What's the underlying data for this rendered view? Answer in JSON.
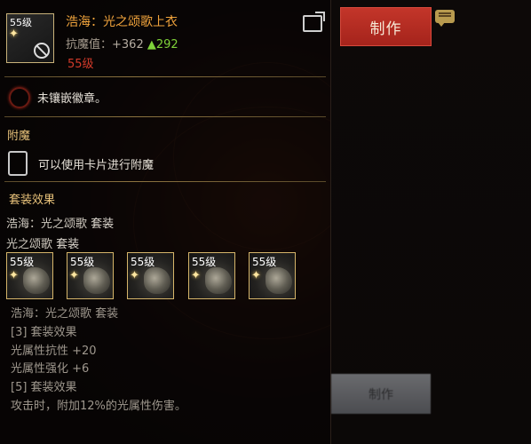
{
  "item": {
    "level_badge": "55级",
    "name": "浩海：光之颂歌上衣",
    "stat_label": "抗魔值：",
    "stat_value": "+362",
    "stat_increase": "▲292",
    "required_level": "55级"
  },
  "badge": {
    "text": "未镶嵌徽章。"
  },
  "enchant": {
    "header": "附魔",
    "hint": "可以使用卡片进行附魔"
  },
  "set": {
    "header": "套装效果",
    "line1_prefix": "浩海：光之颂歌",
    "line1_suffix": "套装",
    "line2_prefix": "光之颂歌",
    "line2_suffix": "套装",
    "pieces": [
      {
        "level": "55级"
      },
      {
        "level": "55级"
      },
      {
        "level": "55级"
      },
      {
        "level": "55级"
      },
      {
        "level": "55级"
      }
    ],
    "effects_title": "浩海：光之颂歌 套装",
    "effects": [
      "[3] 套装效果",
      "光属性抗性 +20",
      "光属性强化 +6",
      "[5] 套装效果",
      "攻击时，附加12%的光属性伤害。"
    ]
  },
  "right": {
    "craft_label": "制作",
    "craft_label_disabled": "制作"
  },
  "colors": {
    "title": "#f0a33c",
    "increase": "#7fd23a",
    "warning": "#d23a2a",
    "section": "#e8c27a",
    "button": "#c4362a"
  }
}
